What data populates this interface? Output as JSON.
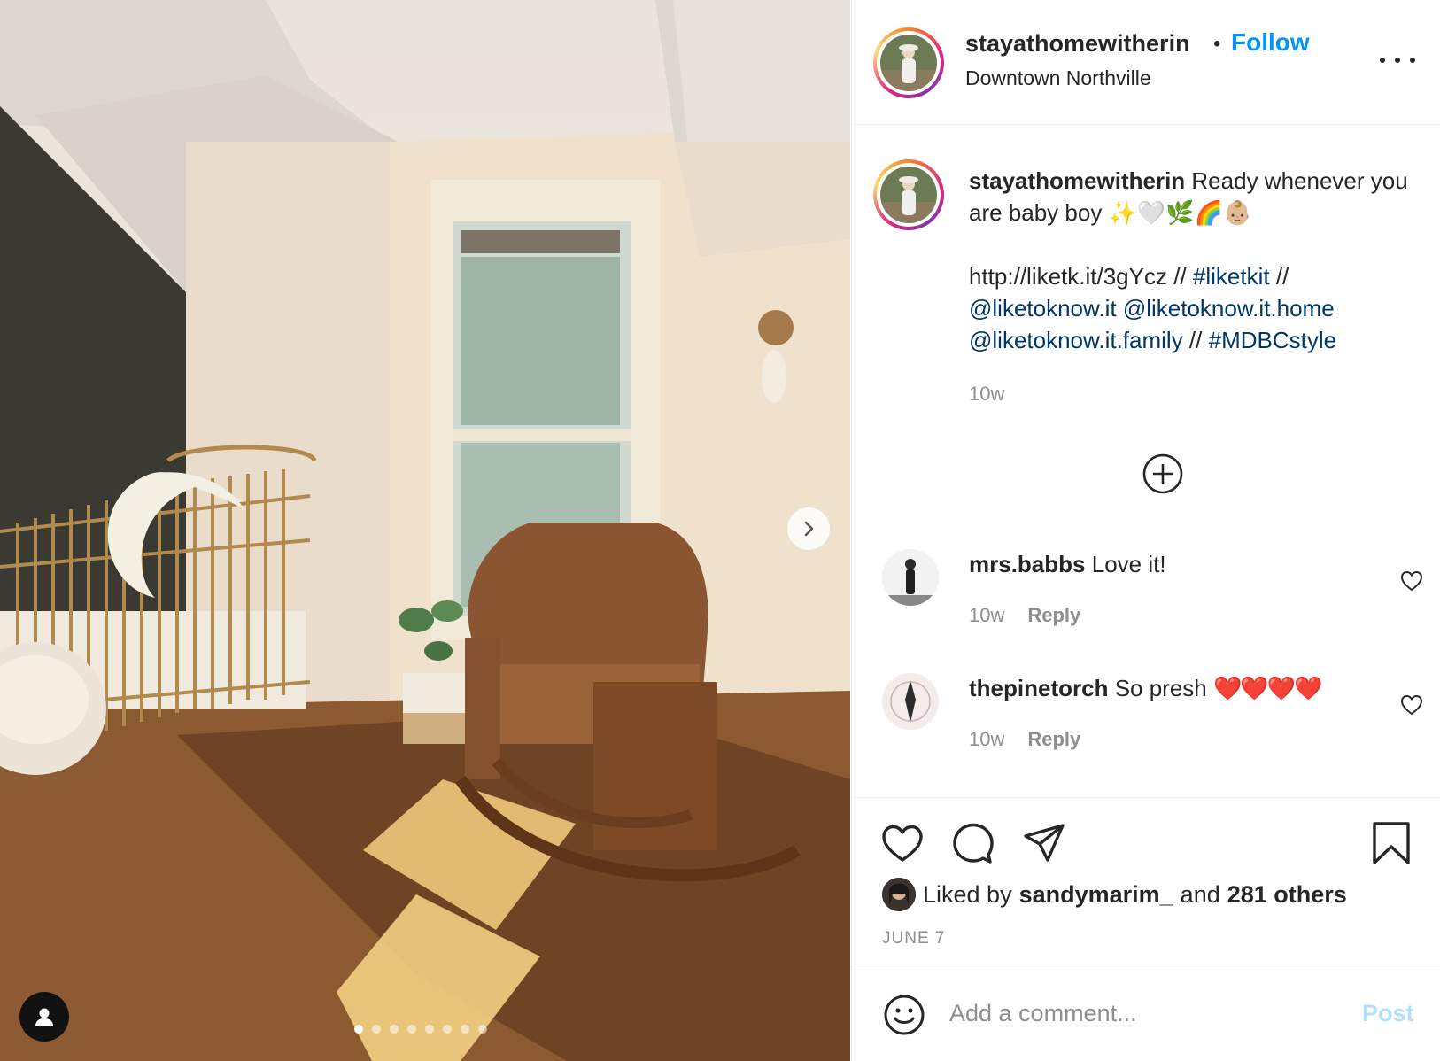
{
  "post": {
    "author": "stayathomewitherin",
    "separator": "•",
    "follow_label": "Follow",
    "location": "Downtown Northville"
  },
  "caption": {
    "author": "stayathomewitherin",
    "text": "Ready whenever you are baby boy ✨🤍🌿🌈👶🏼",
    "link_url": "http://liketk.it/3gYcz",
    "sep1": " // ",
    "hashtag1": "#liketkit",
    "sep2": " //",
    "mention1": "@liketoknow.it",
    "mention2": "@liketoknow.it.home",
    "mention3": "@liketoknow.it.family",
    "sep3": " // ",
    "hashtag2": "#MDBCstyle",
    "time": "10w"
  },
  "comments": [
    {
      "user": "mrs.babbs",
      "text": "Love it!",
      "time": "10w",
      "reply_label": "Reply"
    },
    {
      "user": "thepinetorch",
      "text": "So presh",
      "hearts": "❤️❤️❤️❤️",
      "time": "10w",
      "reply_label": "Reply"
    }
  ],
  "likes": {
    "prefix": "Liked by",
    "user": "sandymarim_",
    "middle": "and",
    "others": "281 others"
  },
  "date": "JUNE 7",
  "comment_box": {
    "placeholder": "Add a comment...",
    "post_label": "Post"
  },
  "carousel": {
    "total": 8,
    "active": 1
  },
  "colors": {
    "link": "#00376b",
    "follow": "#0095f6",
    "post_disabled": "#b2dffc",
    "muted": "#8e8e8e"
  }
}
